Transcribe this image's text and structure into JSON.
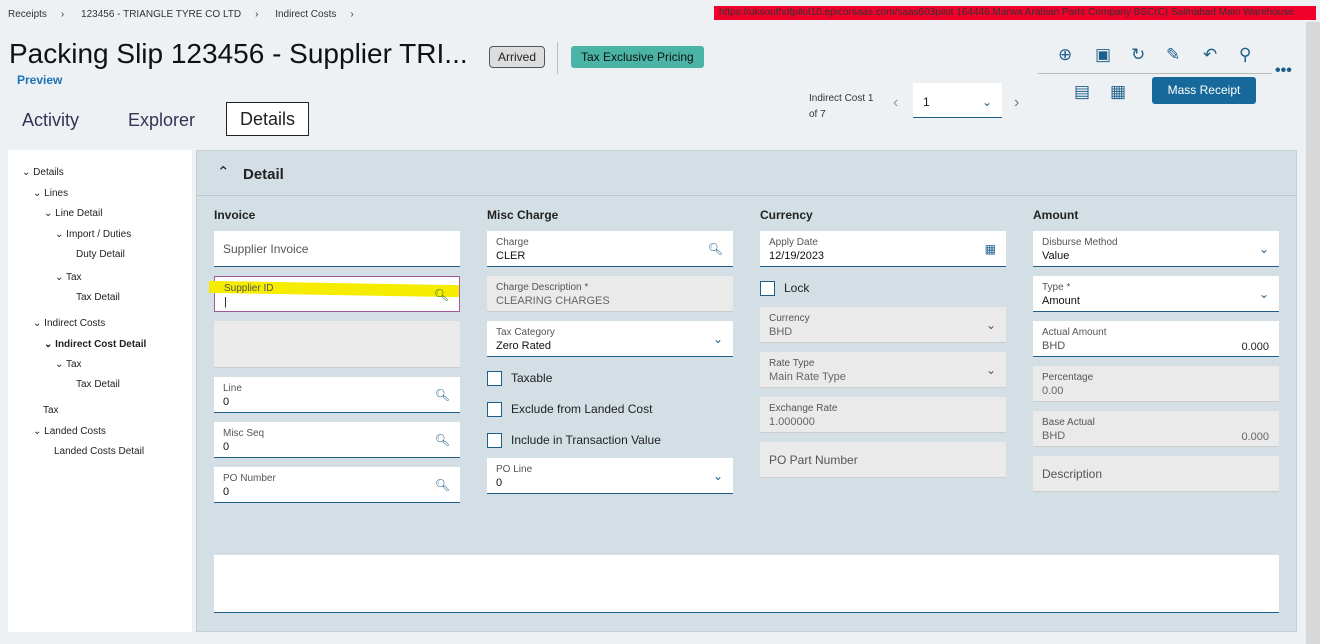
{
  "breadcrumb": [
    "Receipts",
    "123456 - TRIANGLE TYRE CO LTD",
    "Indirect Costs"
  ],
  "session_info": "https://uksouthdtpilot10.epicorsaas.com/saas603pilot   164446.Marwa   Arabian Parts Company BSC(C)   Salmabad Main Warehouse",
  "title": "Packing Slip 123456 - Supplier TRI...",
  "preview": "Preview",
  "status_badge": "Arrived",
  "pricing_badge": "Tax Exclusive Pricing",
  "tabs": [
    "Activity",
    "Explorer",
    "Details"
  ],
  "nav": {
    "label1": "Indirect Cost 1",
    "label2": "of 7",
    "value": "1"
  },
  "mass_receipt": "Mass Receipt",
  "tree": [
    "Details",
    "Lines",
    "Line Detail",
    "Import / Duties",
    "Duty Detail",
    "Tax",
    "Tax Detail",
    "Indirect Costs",
    "Indirect Cost Detail",
    "Tax",
    "Tax Detail",
    "Tax",
    "Landed Costs",
    "Landed Costs Detail"
  ],
  "section": "Detail",
  "invoice": {
    "title": "Invoice",
    "supplier_invoice": "Supplier Invoice",
    "supplier_id_label": "Supplier ID",
    "line_label": "Line",
    "line": "0",
    "misc_seq_label": "Misc Seq",
    "misc_seq": "0",
    "po_number_label": "PO Number",
    "po_number": "0"
  },
  "misc": {
    "title": "Misc Charge",
    "charge_label": "Charge",
    "charge": "CLER",
    "desc_label": "Charge Description *",
    "desc": "CLEARING CHARGES",
    "taxcat_label": "Tax Category",
    "taxcat": "Zero Rated",
    "taxable": "Taxable",
    "exclude": "Exclude from Landed Cost",
    "include": "Include in Transaction Value",
    "poline_label": "PO Line",
    "poline": "0"
  },
  "currency": {
    "title": "Currency",
    "apply_label": "Apply Date",
    "apply": "12/19/2023",
    "lock": "Lock",
    "cur_label": "Currency",
    "cur": "BHD",
    "rate_label": "Rate Type",
    "rate": "Main Rate Type",
    "ex_label": "Exchange Rate",
    "ex": "1.000000",
    "popart": "PO Part Number"
  },
  "amount": {
    "title": "Amount",
    "disb_label": "Disburse Method",
    "disb": "Value",
    "type_label": "Type *",
    "type": "Amount",
    "actual_label": "Actual Amount",
    "actual_cur": "BHD",
    "actual": "0.000",
    "pct_label": "Percentage",
    "pct": "0.00",
    "base_label": "Base Actual",
    "base_cur": "BHD",
    "base": "0.000",
    "desc": "Description"
  }
}
